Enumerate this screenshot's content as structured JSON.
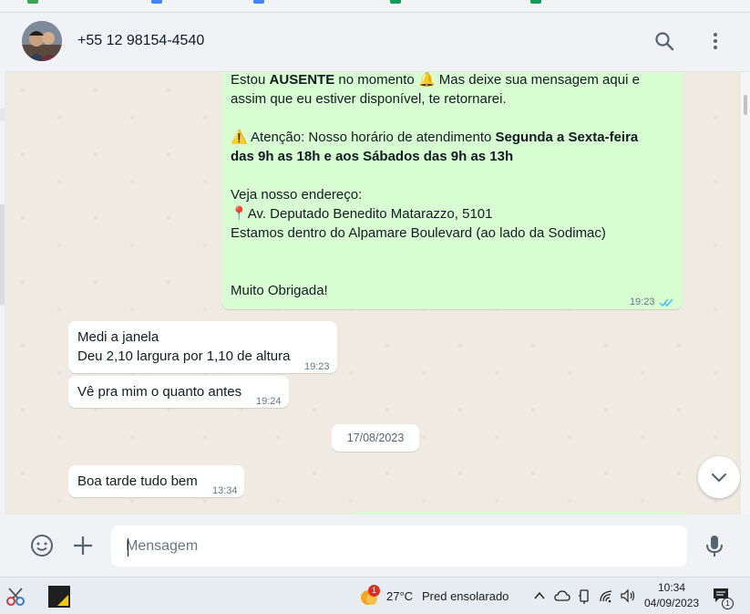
{
  "contact": {
    "name": "+55 12 98154-4540"
  },
  "icons": {
    "search": "search-icon",
    "menu": "kebab-menu-icon",
    "emoji": "emoji-icon",
    "attach": "plus-icon",
    "mic": "microphone-icon",
    "scroll_down": "chevron-down-icon",
    "read_receipt": "double-check-icon"
  },
  "messages": {
    "away": {
      "line1_pre": "Estou ",
      "line1_bold": "AUSENTE",
      "line1_post": " no momento",
      "line1_emoji": "🔔",
      "line1_tail": " Mas deixe sua mensagem aqui e",
      "line2": "assim que eu estiver disponível, te retornarei.",
      "warn_emoji": "⚠️",
      "warn_pre": " Atenção: Nosso horário de atendimento ",
      "warn_bold1": "Segunda a Sexta-feira",
      "warn_bold2": "das 9h as 18h e aos Sábados das 9h as 13h",
      "addr_label": "Veja nosso endereço:",
      "pin_emoji": "📍",
      "addr_line": "Av. Deputado Benedito Matarazzo, 5101",
      "addr_note": "Estamos dentro do Alpamare Boulevard (ao lado da Sodimac)",
      "thanks": "Muito Obrigada!",
      "time": "19:23"
    },
    "in1": {
      "line1": "Medi a janela",
      "line2": "Deu 2,10 largura por 1,10 de altura",
      "time": "19:23"
    },
    "in2": {
      "text": "Vê pra mim o quanto antes",
      "time": "19:24"
    },
    "date_divider": "17/08/2023",
    "in3": {
      "text": "Boa tarde tudo bem",
      "time": "13:34"
    }
  },
  "composer": {
    "placeholder": "Mensagem"
  },
  "taskbar": {
    "weather_badge": "1",
    "temperature": "27°C",
    "weather_desc": "Pred ensolarado",
    "time": "10:34",
    "date": "04/09/2023",
    "notif_count": "1"
  },
  "colors": {
    "outgoing": "#d9fdd3",
    "incoming": "#ffffff",
    "chat_bg": "#efeae2",
    "panel": "#f0f2f5",
    "read_blue": "#53bdeb"
  }
}
